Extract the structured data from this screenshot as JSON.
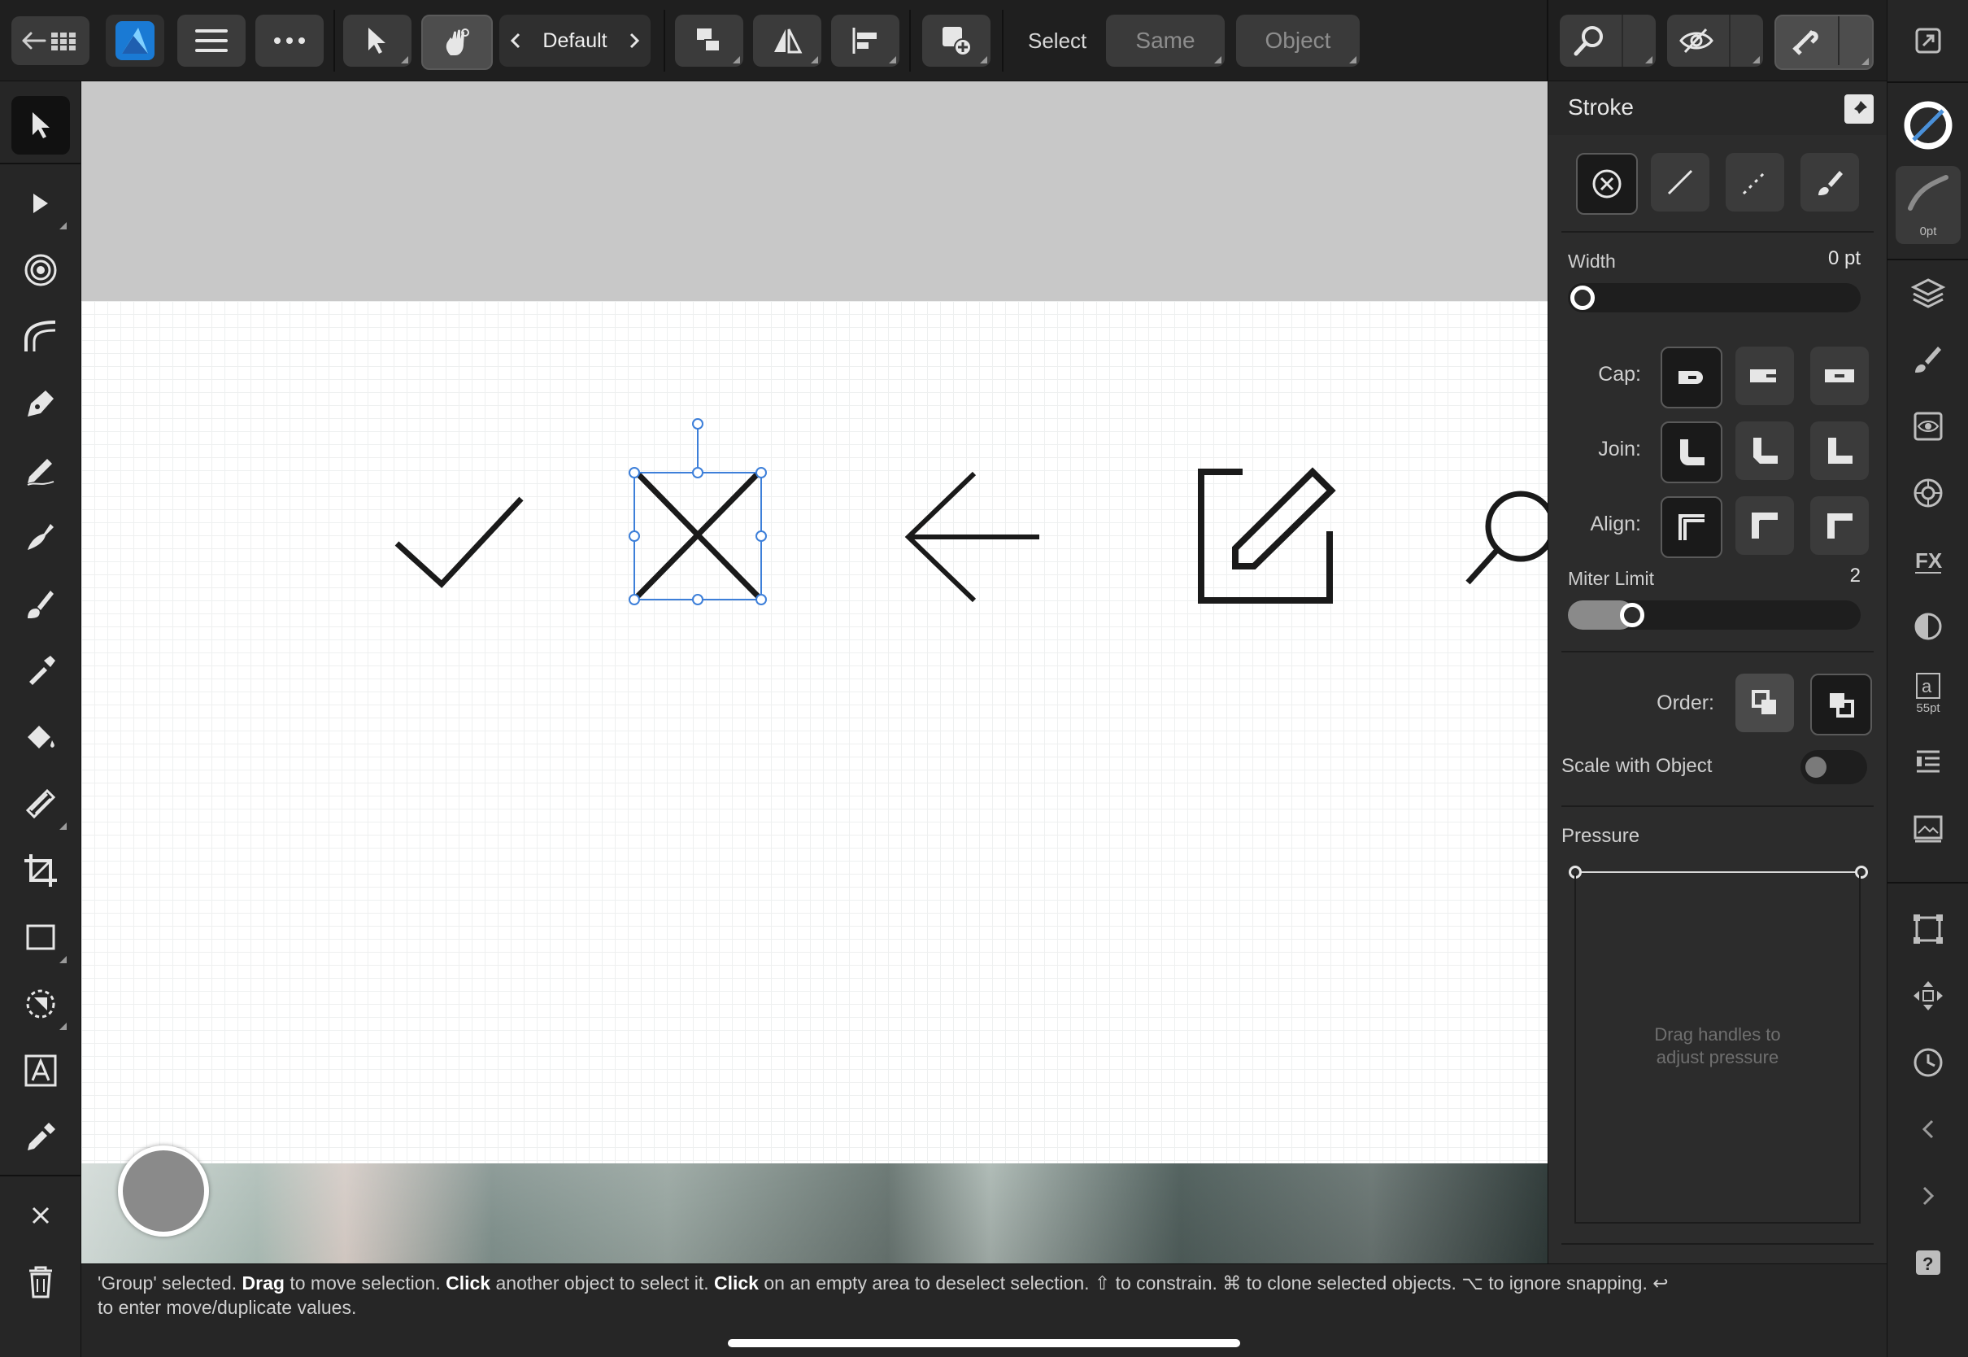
{
  "toolbar": {
    "persona_label": "Default",
    "select_label": "Select",
    "same_label": "Same",
    "object_label": "Object"
  },
  "stroke_panel": {
    "title": "Stroke",
    "width_label": "Width",
    "width_value": "0 pt",
    "width_fraction": 0,
    "cap_label": "Cap:",
    "join_label": "Join:",
    "align_label": "Align:",
    "miter_label": "Miter Limit",
    "miter_value": "2",
    "order_label": "Order:",
    "scale_label": "Scale with Object",
    "scale_on": false,
    "pressure_label": "Pressure",
    "pressure_hint_line1": "Drag handles to",
    "pressure_hint_line2": "adjust pressure"
  },
  "studio": {
    "stroke_swatch_label": "0pt",
    "text_style_label": "55pt"
  },
  "status": {
    "p1": "'Group' selected. ",
    "b1": "Drag",
    "p2": " to move selection. ",
    "b2": "Click",
    "p3": " another object to select it. ",
    "b3": "Click",
    "p4": " on an empty area to deselect selection. ⇧ to constrain. ⌘ to clone selected objects. ⌥ to ignore snapping. ↩",
    "line2": "to enter move/duplicate values."
  },
  "colors": {
    "accent": "#4a90d9",
    "selection": "#3d7fd9",
    "panel_bg": "#2c2c2c",
    "toolbar_bg": "#1f1f1f"
  }
}
